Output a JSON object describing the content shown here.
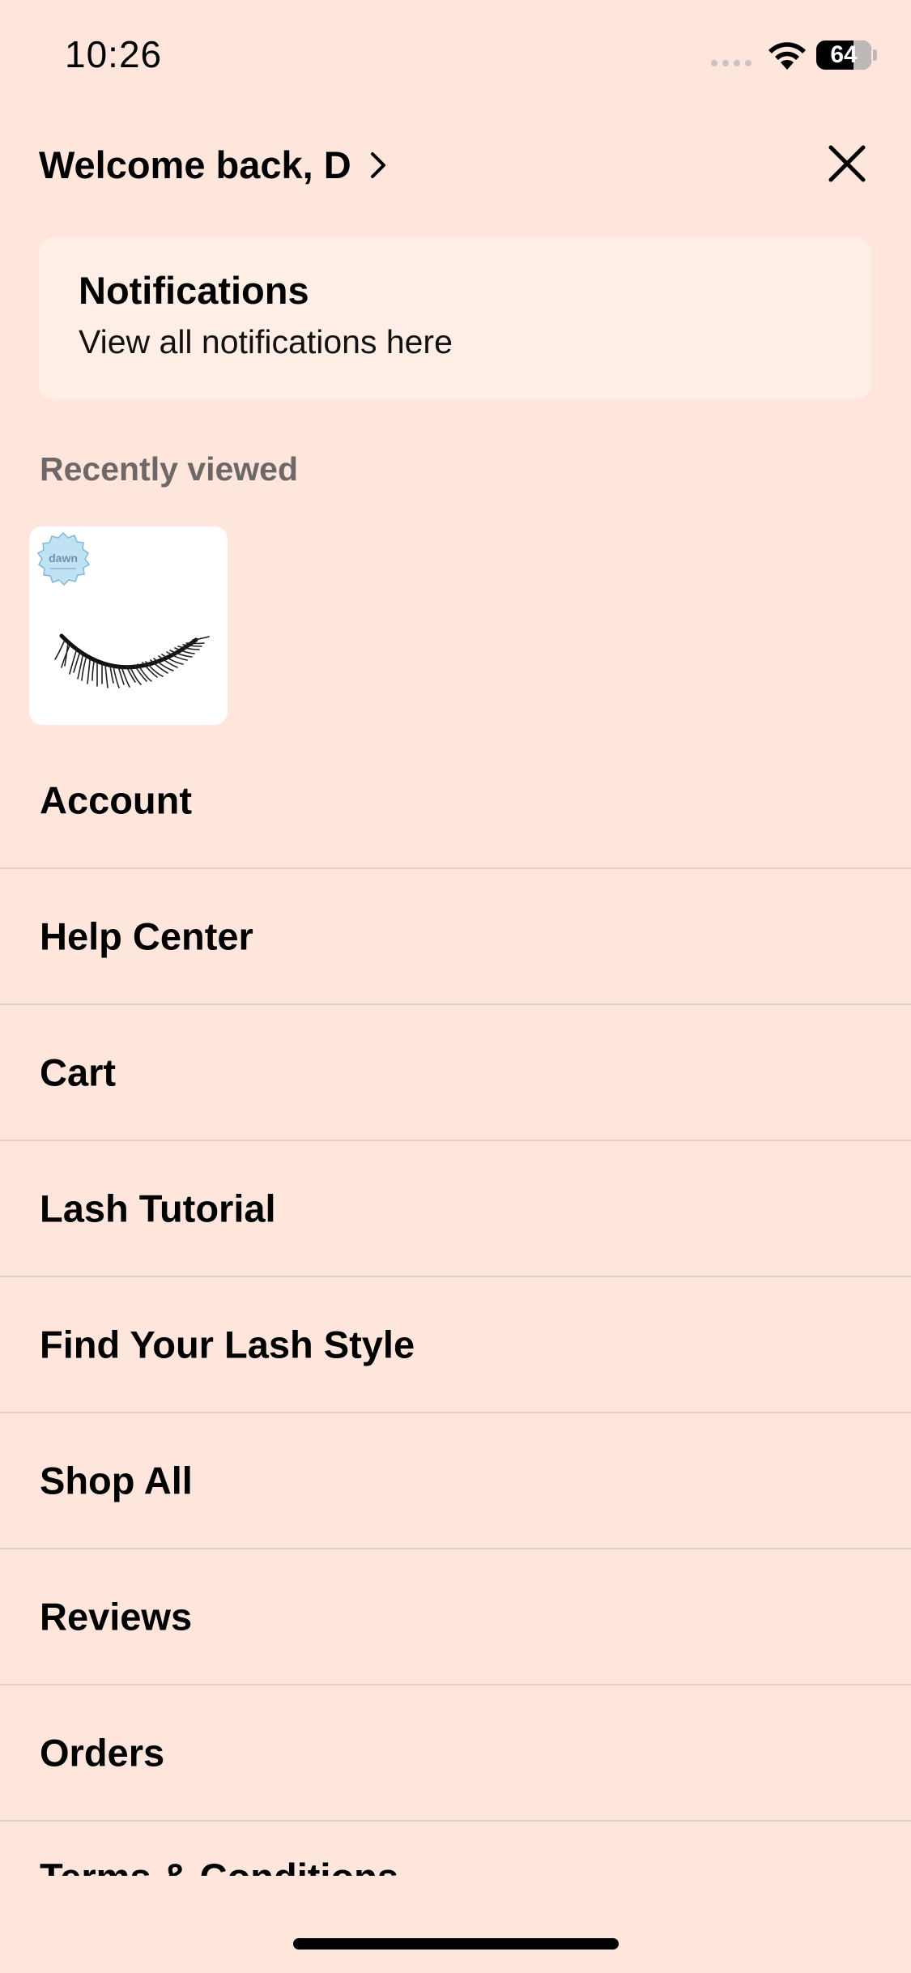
{
  "status_bar": {
    "time": "10:26",
    "battery": "64"
  },
  "header": {
    "welcome": "Welcome back, D"
  },
  "notifications": {
    "title": "Notifications",
    "subtitle": "View all notifications here"
  },
  "recently_viewed": {
    "label": "Recently viewed",
    "items": [
      {
        "badge_text": "dawn"
      }
    ]
  },
  "menu": {
    "items": [
      {
        "label": "Account"
      },
      {
        "label": "Help Center"
      },
      {
        "label": "Cart"
      },
      {
        "label": "Lash Tutorial"
      },
      {
        "label": "Find Your Lash Style"
      },
      {
        "label": "Shop All"
      },
      {
        "label": "Reviews"
      },
      {
        "label": "Orders"
      },
      {
        "label": "Terms & Conditions"
      }
    ]
  },
  "colors": {
    "background": "#FFE6DC",
    "card": "#FFEEE6",
    "divider": "#DDD0CA"
  }
}
